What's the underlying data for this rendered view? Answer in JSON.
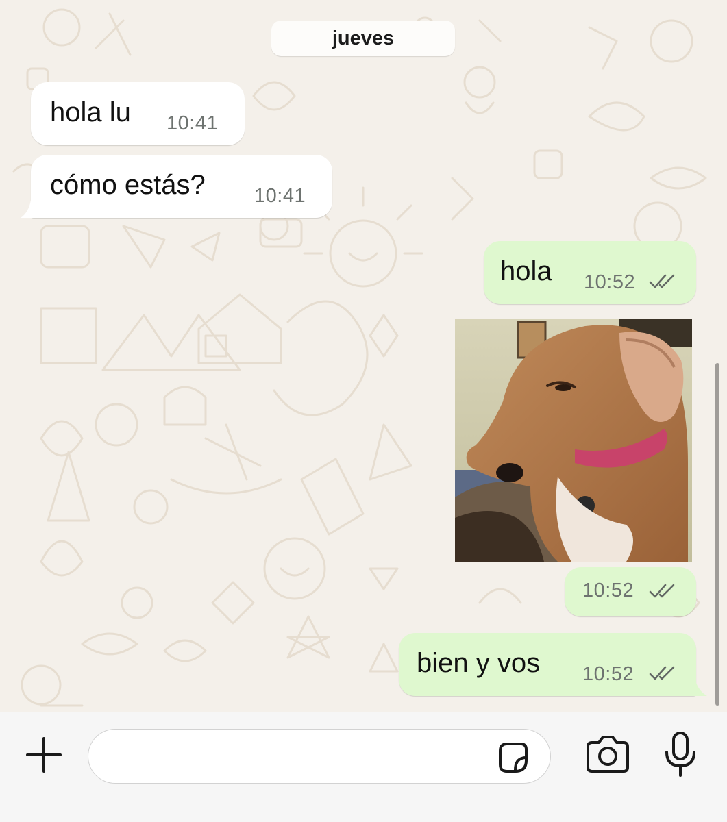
{
  "date_separator": "jueves",
  "messages": [
    {
      "direction": "incoming",
      "type": "text",
      "text": "hola lu",
      "time": "10:41"
    },
    {
      "direction": "incoming",
      "type": "text",
      "text": "cómo estás?",
      "time": "10:41"
    },
    {
      "direction": "outgoing",
      "type": "text",
      "text": "hola",
      "time": "10:52",
      "status": "read-double-check-icon"
    },
    {
      "direction": "outgoing",
      "type": "image",
      "image_description": "dachshund-side-eye-photo"
    },
    {
      "direction": "outgoing",
      "type": "image-caption",
      "time": "10:52",
      "status": "read-double-check-icon"
    },
    {
      "direction": "outgoing",
      "type": "text",
      "text": "bien y vos",
      "time": "10:52",
      "status": "read-double-check-icon"
    }
  ],
  "composer": {
    "value": "",
    "placeholder": "",
    "icons": [
      "plus-icon",
      "sticker-icon",
      "camera-icon",
      "microphone-icon"
    ]
  },
  "colors": {
    "incoming_bubble": "#ffffff",
    "outgoing_bubble": "#dff8cf",
    "wallpaper": "#f4f0ea",
    "tick_color": "#6e7370"
  }
}
